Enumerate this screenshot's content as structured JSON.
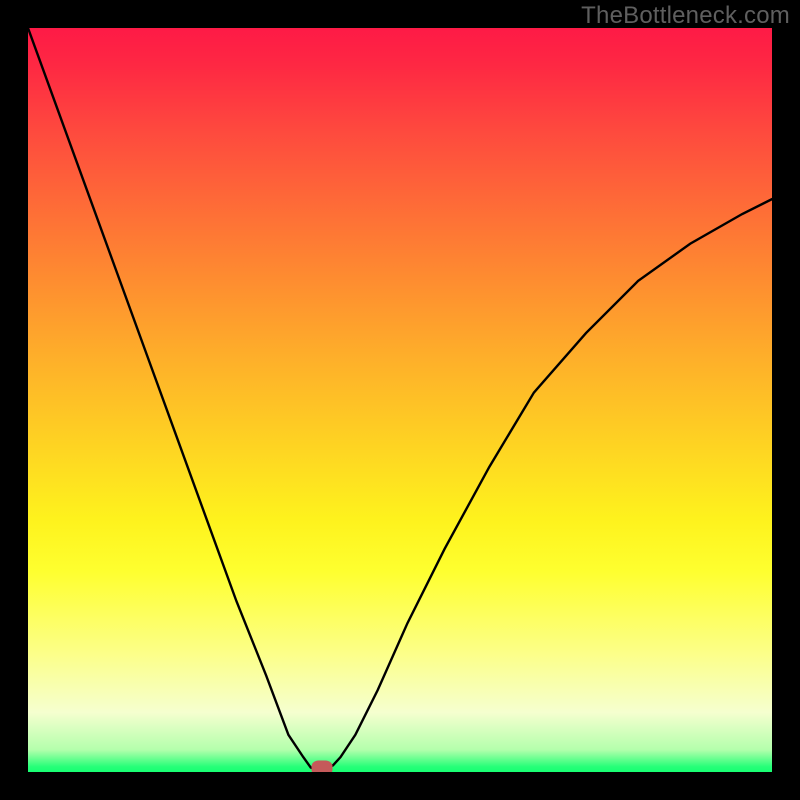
{
  "watermark": "TheBottleneck.com",
  "chart_data": {
    "type": "line",
    "title": "",
    "xlabel": "",
    "ylabel": "",
    "xlim": [
      0,
      100
    ],
    "ylim": [
      0,
      100
    ],
    "grid": false,
    "legend": false,
    "background": "red-yellow-green vertical gradient",
    "series": [
      {
        "name": "bottleneck-curve",
        "x": [
          0,
          4,
          8,
          12,
          16,
          20,
          24,
          28,
          32,
          35,
          37,
          38,
          39,
          40,
          41,
          42,
          44,
          47,
          51,
          56,
          62,
          68,
          75,
          82,
          89,
          96,
          100
        ],
        "y": [
          100,
          89,
          78,
          67,
          56,
          45,
          34,
          23,
          13,
          5,
          2,
          0.6,
          0.2,
          0.3,
          0.9,
          2,
          5,
          11,
          20,
          30,
          41,
          51,
          59,
          66,
          71,
          75,
          77
        ]
      }
    ],
    "marker": {
      "x": 39.5,
      "y": 0.6,
      "color": "#c55a5a"
    },
    "gradient_stops": [
      {
        "pos": 0.0,
        "color": "#fe1a46"
      },
      {
        "pos": 0.55,
        "color": "#fed023"
      },
      {
        "pos": 0.73,
        "color": "#feff2f"
      },
      {
        "pos": 0.97,
        "color": "#b4ffac"
      },
      {
        "pos": 1.0,
        "color": "#17ff73"
      }
    ]
  }
}
